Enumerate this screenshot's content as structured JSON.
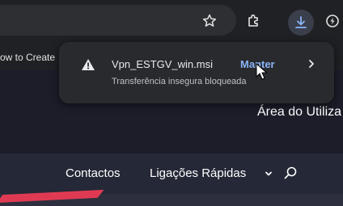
{
  "bookmarks": {
    "item_text": "ow to Create"
  },
  "toolbar": {
    "icons": [
      "star-icon",
      "extensions-icon",
      "download-icon",
      "extension-icon"
    ]
  },
  "download_bubble": {
    "file_name": "Vpn_ESTGV_win.msi",
    "status": "Transferência insegura bloqueada",
    "keep_label": "Manter",
    "warning_icon": "warning-triangle-icon"
  },
  "site": {
    "area_label": "Área do Utiliza",
    "nav": {
      "contactos": "Contactos",
      "ligacoes": "Ligações Rápidas"
    }
  },
  "colors": {
    "accent_link": "#8ab4f8",
    "brand_red": "#e03a52"
  }
}
